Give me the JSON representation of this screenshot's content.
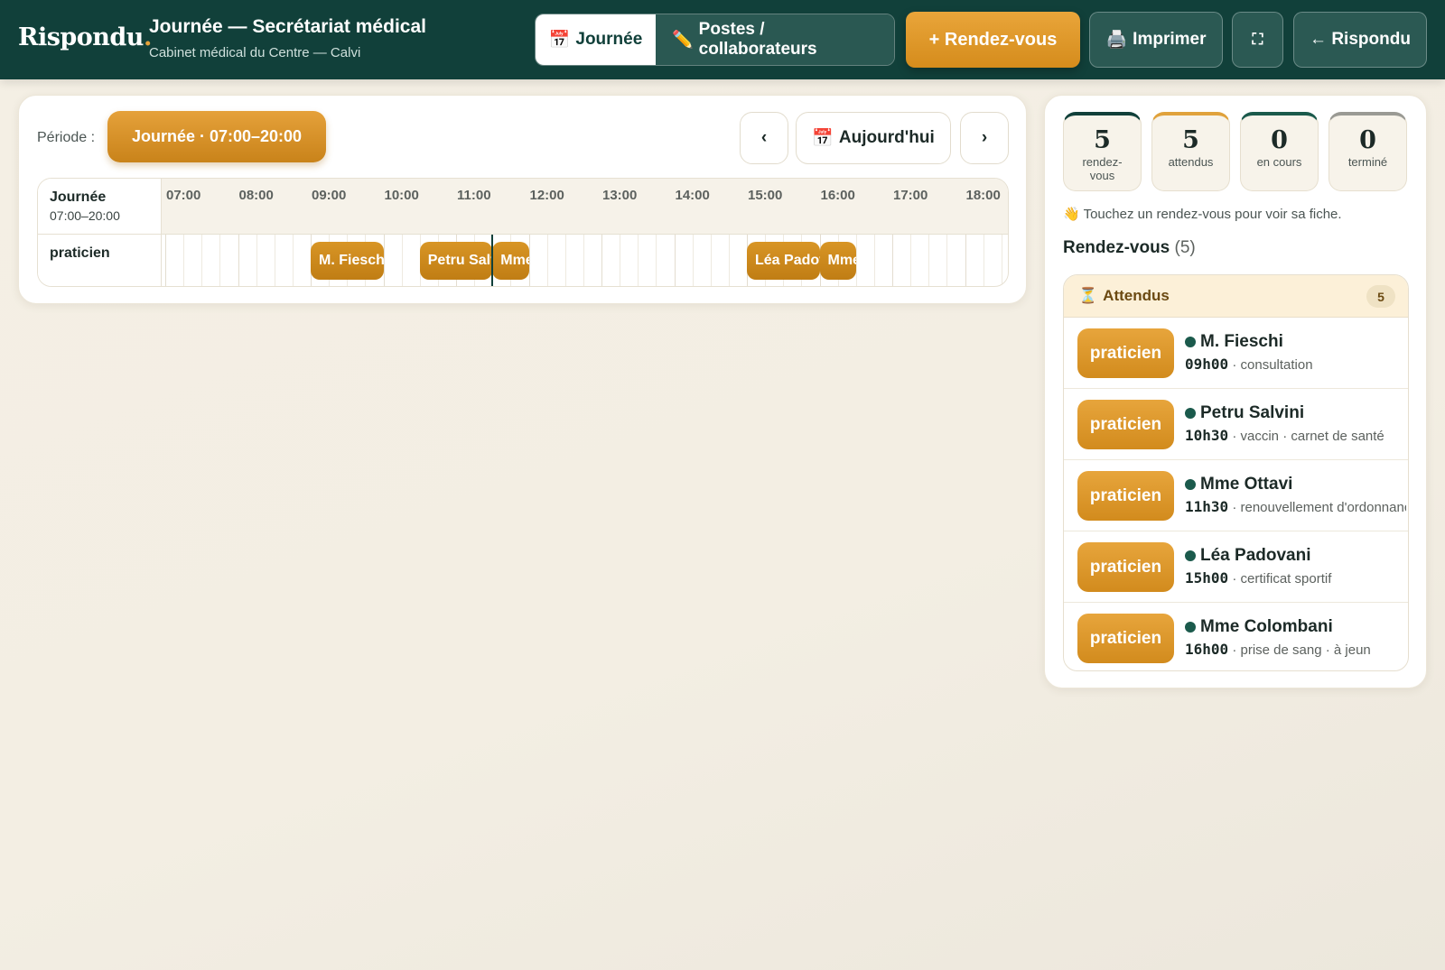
{
  "header": {
    "logo": "Rispondu",
    "logo_dot": ".",
    "title": "Journée — Secrétariat médical",
    "subtitle": "Cabinet médical du Centre — Calvi",
    "tabs": [
      {
        "label": "Journée",
        "icon": "📅",
        "active": true
      },
      {
        "label": "Postes / collaborateurs",
        "icon": "✏️",
        "active": false
      }
    ],
    "new_appointment": "+ Rendez-vous",
    "print": {
      "icon": "🖨️",
      "label": "Imprimer"
    },
    "fullscreen_icon": "⛶",
    "back": "← Rispondu"
  },
  "timeline": {
    "period_label": "Période :",
    "period_value": "Journée · 07:00–20:00",
    "prev": "‹",
    "today": {
      "icon": "📅",
      "label": "Aujourd'hui"
    },
    "next": "›",
    "corner_title": "Journée",
    "corner_range": "07:00–20:00",
    "row_label": "praticien",
    "hours": [
      "07:00",
      "08:00",
      "09:00",
      "10:00",
      "11:00",
      "12:00",
      "13:00",
      "14:00",
      "15:00",
      "16:00",
      "17:00",
      "18:00"
    ],
    "now": "11:30",
    "appointments": [
      {
        "label": "M. Fieschi",
        "start": "09:00",
        "duration_min": 60
      },
      {
        "label": "Petru Salvini",
        "start": "10:30",
        "duration_min": 60
      },
      {
        "label": "Mme Ottavi",
        "start": "11:30",
        "duration_min": 30
      },
      {
        "label": "Léa Padovani",
        "start": "15:00",
        "duration_min": 60
      },
      {
        "label": "Mme Colombani",
        "start": "16:00",
        "duration_min": 30
      }
    ]
  },
  "stats": [
    {
      "value": "5",
      "label": "rendez-vous",
      "color": "#11403a"
    },
    {
      "value": "5",
      "label": "attendus",
      "color": "#e0a23c"
    },
    {
      "value": "0",
      "label": "en cours",
      "color": "#1b5a4c"
    },
    {
      "value": "0",
      "label": "terminé",
      "color": "#9a9a94"
    }
  ],
  "hint": "👋 Touchez un rendez-vous pour voir sa fiche.",
  "list": {
    "title": "Rendez-vous",
    "count": "(5)",
    "group_icon": "⏳",
    "group_label": "Attendus",
    "group_count": "5",
    "items": [
      {
        "chip": "praticien",
        "name": "M. Fieschi",
        "time": "09h00",
        "detail": "· consultation"
      },
      {
        "chip": "praticien",
        "name": "Petru Salvini",
        "time": "10h30",
        "detail": "· vaccin · carnet de santé"
      },
      {
        "chip": "praticien",
        "name": "Mme Ottavi",
        "time": "11h30",
        "detail": "· renouvellement d'ordonnance"
      },
      {
        "chip": "praticien",
        "name": "Léa Padovani",
        "time": "15h00",
        "detail": "· certificat sportif"
      },
      {
        "chip": "praticien",
        "name": "Mme Colombani",
        "time": "16h00",
        "detail": "· prise de sang · à jeun"
      }
    ]
  },
  "colors": {
    "brand": "#11403a",
    "accent": "#e0a23c",
    "status_dot": "#1b5a4c"
  }
}
